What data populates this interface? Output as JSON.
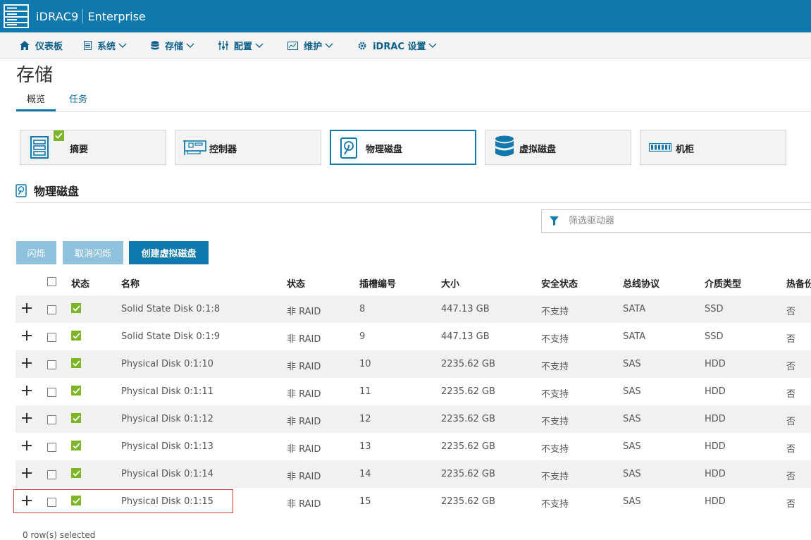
{
  "app": {
    "brand": "iDRAC9",
    "edition": "Enterprise"
  },
  "nav": [
    {
      "label": "仪表板",
      "icon": "home-icon"
    },
    {
      "label": "系统",
      "icon": "server-icon"
    },
    {
      "label": "存储",
      "icon": "database-icon"
    },
    {
      "label": "配置",
      "icon": "sliders-icon"
    },
    {
      "label": "维护",
      "icon": "monitor-icon"
    },
    {
      "label": "iDRAC 设置",
      "icon": "gear-icon"
    }
  ],
  "page": {
    "title": "存储"
  },
  "tabs": [
    {
      "label": "概览",
      "active": true
    },
    {
      "label": "任务",
      "active": false
    }
  ],
  "cards": [
    {
      "label": "摘要",
      "icon": "summary-icon",
      "checked": true
    },
    {
      "label": "控制器",
      "icon": "controller-icon"
    },
    {
      "label": "物理磁盘",
      "icon": "physical-disk-icon",
      "active": true
    },
    {
      "label": "虚拟磁盘",
      "icon": "virtual-disk-icon"
    },
    {
      "label": "机柜",
      "icon": "enclosure-icon"
    }
  ],
  "section": {
    "title": "物理磁盘"
  },
  "filter": {
    "placeholder": "筛选驱动器"
  },
  "buttons": {
    "blink": "闪烁",
    "unblink": "取消闪烁",
    "create_vd": "创建虚拟磁盘"
  },
  "table": {
    "headers": {
      "status": "状态",
      "name": "名称",
      "state": "状态",
      "slot": "插槽编号",
      "size": "大小",
      "security": "安全状态",
      "bus": "总线协议",
      "media": "介质类型",
      "hotspare": "热备份"
    },
    "rows": [
      {
        "name": "Solid State Disk 0:1:8",
        "state": "非 RAID",
        "slot": "8",
        "size": "447.13 GB",
        "security": "不支持",
        "bus": "SATA",
        "media": "SSD",
        "hotspare": "否"
      },
      {
        "name": "Solid State Disk 0:1:9",
        "state": "非 RAID",
        "slot": "9",
        "size": "447.13 GB",
        "security": "不支持",
        "bus": "SATA",
        "media": "SSD",
        "hotspare": "否"
      },
      {
        "name": "Physical Disk 0:1:10",
        "state": "非 RAID",
        "slot": "10",
        "size": "2235.62 GB",
        "security": "不支持",
        "bus": "SAS",
        "media": "HDD",
        "hotspare": "否"
      },
      {
        "name": "Physical Disk 0:1:11",
        "state": "非 RAID",
        "slot": "11",
        "size": "2235.62 GB",
        "security": "不支持",
        "bus": "SAS",
        "media": "HDD",
        "hotspare": "否"
      },
      {
        "name": "Physical Disk 0:1:12",
        "state": "非 RAID",
        "slot": "12",
        "size": "2235.62 GB",
        "security": "不支持",
        "bus": "SAS",
        "media": "HDD",
        "hotspare": "否"
      },
      {
        "name": "Physical Disk 0:1:13",
        "state": "非 RAID",
        "slot": "13",
        "size": "2235.62 GB",
        "security": "不支持",
        "bus": "SAS",
        "media": "HDD",
        "hotspare": "否"
      },
      {
        "name": "Physical Disk 0:1:14",
        "state": "非 RAID",
        "slot": "14",
        "size": "2235.62 GB",
        "security": "不支持",
        "bus": "SAS",
        "media": "HDD",
        "hotspare": "否"
      },
      {
        "name": "Physical Disk 0:1:15",
        "state": "非 RAID",
        "slot": "15",
        "size": "2235.62 GB",
        "security": "不支持",
        "bus": "SAS",
        "media": "HDD",
        "hotspare": "否"
      }
    ]
  },
  "footer": {
    "selected": "0 row(s) selected"
  },
  "colors": {
    "brand_blue": "#0f78ac",
    "ok_green": "#7cb526",
    "highlight_red": "#d73a30"
  }
}
